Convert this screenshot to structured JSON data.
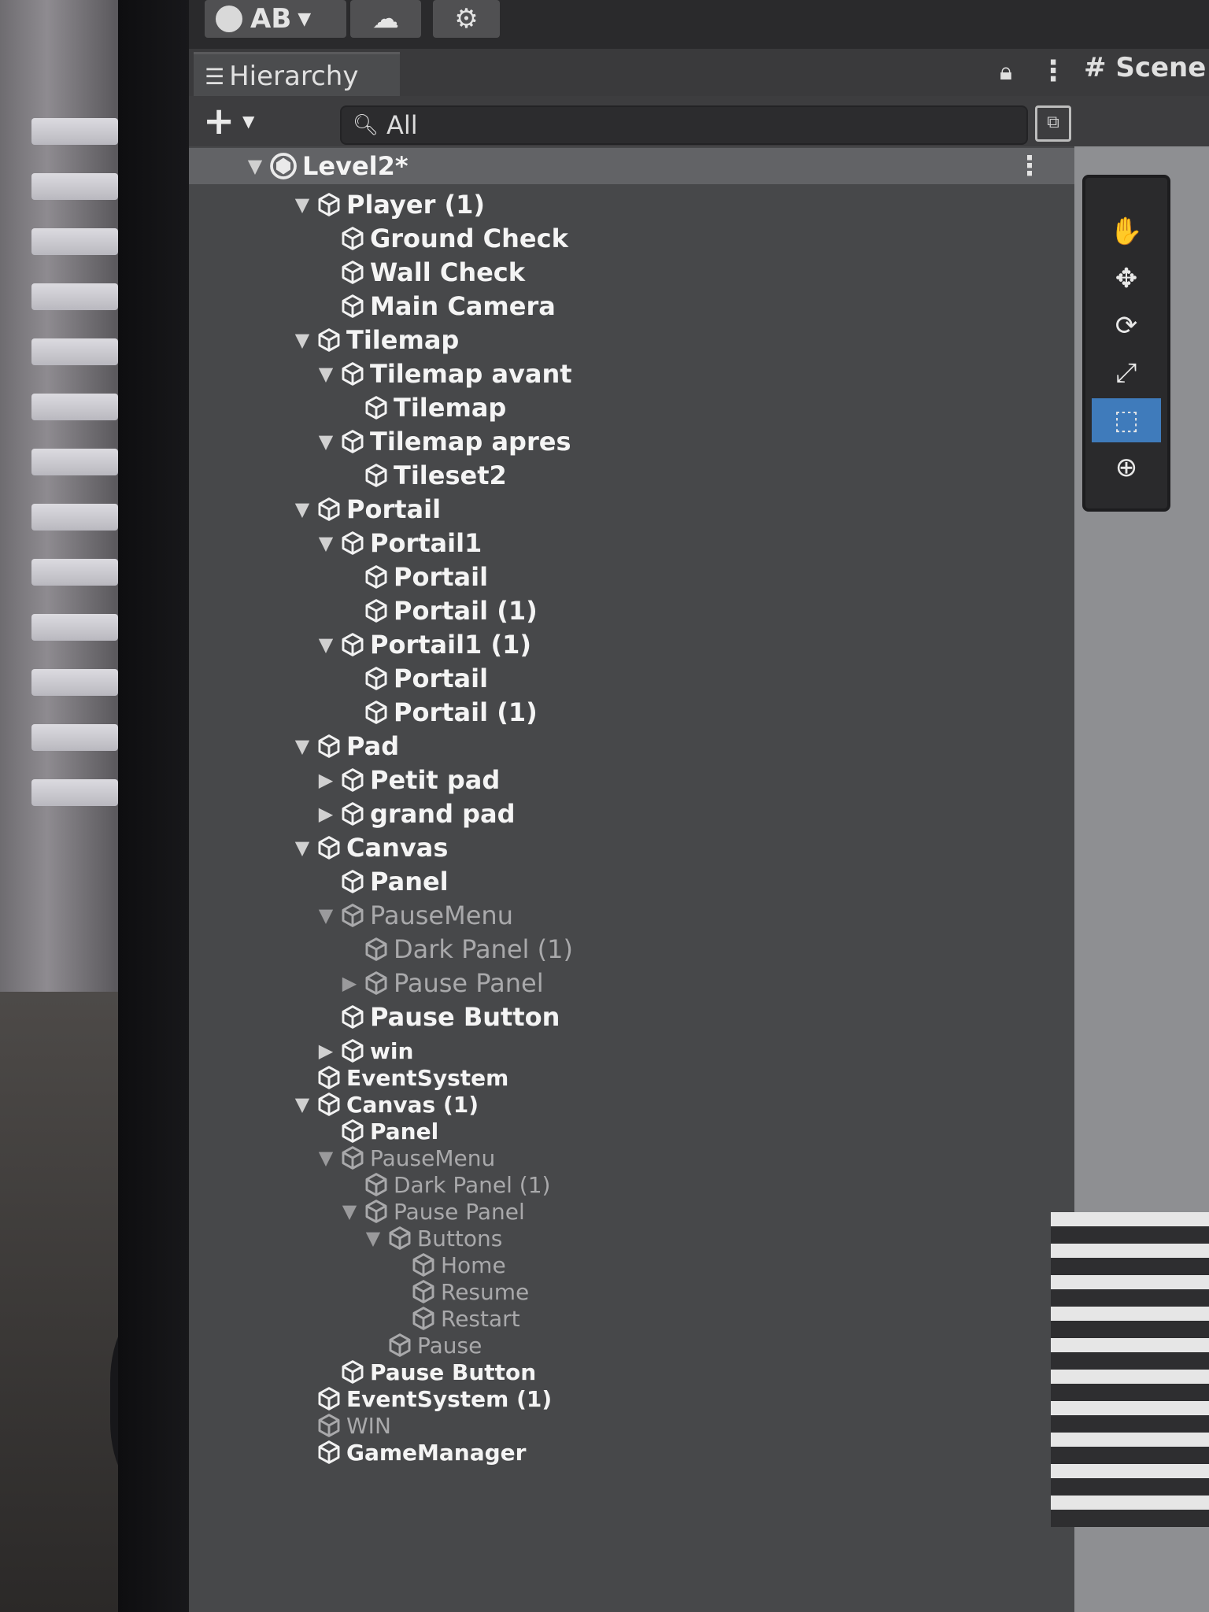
{
  "toolbar": {
    "account_label": "AB",
    "icons": [
      "account-icon",
      "cloud-icon",
      "settings-icon"
    ]
  },
  "hierarchy": {
    "tab_title": "Hierarchy",
    "search_value": "All",
    "scene_name": "Level2*",
    "items": [
      {
        "label": "Player (1)",
        "depth": 1,
        "arrow": "expanded",
        "active": true
      },
      {
        "label": "Ground Check",
        "depth": 2,
        "arrow": "none",
        "active": true
      },
      {
        "label": "Wall Check",
        "depth": 2,
        "arrow": "none",
        "active": true
      },
      {
        "label": "Main Camera",
        "depth": 2,
        "arrow": "none",
        "active": true
      },
      {
        "label": "Tilemap",
        "depth": 1,
        "arrow": "expanded",
        "active": true
      },
      {
        "label": "Tilemap avant",
        "depth": 2,
        "arrow": "expanded",
        "active": true
      },
      {
        "label": "Tilemap",
        "depth": 3,
        "arrow": "none",
        "active": true
      },
      {
        "label": "Tilemap apres",
        "depth": 2,
        "arrow": "expanded",
        "active": true
      },
      {
        "label": "Tileset2",
        "depth": 3,
        "arrow": "none",
        "active": true
      },
      {
        "label": "Portail",
        "depth": 1,
        "arrow": "expanded",
        "active": true
      },
      {
        "label": "Portail1",
        "depth": 2,
        "arrow": "expanded",
        "active": true
      },
      {
        "label": "Portail",
        "depth": 3,
        "arrow": "none",
        "active": true
      },
      {
        "label": "Portail (1)",
        "depth": 3,
        "arrow": "none",
        "active": true
      },
      {
        "label": "Portail1 (1)",
        "depth": 2,
        "arrow": "expanded",
        "active": true
      },
      {
        "label": "Portail",
        "depth": 3,
        "arrow": "none",
        "active": true
      },
      {
        "label": "Portail (1)",
        "depth": 3,
        "arrow": "none",
        "active": true
      },
      {
        "label": "Pad",
        "depth": 1,
        "arrow": "expanded",
        "active": true
      },
      {
        "label": "Petit pad",
        "depth": 2,
        "arrow": "collapsed",
        "active": true
      },
      {
        "label": "grand pad",
        "depth": 2,
        "arrow": "collapsed",
        "active": true
      },
      {
        "label": "Canvas",
        "depth": 1,
        "arrow": "expanded",
        "active": true
      },
      {
        "label": "Panel",
        "depth": 2,
        "arrow": "none",
        "active": true
      },
      {
        "label": "PauseMenu",
        "depth": 2,
        "arrow": "expanded",
        "active": false
      },
      {
        "label": "Dark Panel (1)",
        "depth": 3,
        "arrow": "none",
        "active": false
      },
      {
        "label": "Pause Panel",
        "depth": 3,
        "arrow": "collapsed",
        "active": false
      },
      {
        "label": "Pause Button",
        "depth": 2,
        "arrow": "none",
        "active": true
      },
      {
        "label": "win",
        "depth": 2,
        "arrow": "collapsed",
        "active": true
      },
      {
        "label": "EventSystem",
        "depth": 1,
        "arrow": "none",
        "active": true
      },
      {
        "label": "Canvas (1)",
        "depth": 1,
        "arrow": "expanded",
        "active": true
      },
      {
        "label": "Panel",
        "depth": 2,
        "arrow": "none",
        "active": true
      },
      {
        "label": "PauseMenu",
        "depth": 2,
        "arrow": "expanded",
        "active": false
      },
      {
        "label": "Dark Panel (1)",
        "depth": 3,
        "arrow": "none",
        "active": false
      },
      {
        "label": "Pause Panel",
        "depth": 3,
        "arrow": "expanded",
        "active": false
      },
      {
        "label": "Buttons",
        "depth": 4,
        "arrow": "expanded",
        "active": false
      },
      {
        "label": "Home",
        "depth": 5,
        "arrow": "none",
        "active": false
      },
      {
        "label": "Resume",
        "depth": 5,
        "arrow": "none",
        "active": false
      },
      {
        "label": "Restart",
        "depth": 5,
        "arrow": "none",
        "active": false
      },
      {
        "label": "Pause",
        "depth": 4,
        "arrow": "none",
        "active": false
      },
      {
        "label": "Pause Button",
        "depth": 2,
        "arrow": "none",
        "active": true
      },
      {
        "label": "EventSystem (1)",
        "depth": 1,
        "arrow": "none",
        "active": true
      },
      {
        "label": "WIN",
        "depth": 1,
        "arrow": "none",
        "active": false
      },
      {
        "label": "GameManager",
        "depth": 1,
        "arrow": "none",
        "active": true
      }
    ]
  },
  "scene": {
    "tab_title": "Scene",
    "tools": [
      "hand-icon",
      "move-icon",
      "rotate-icon",
      "scale-icon",
      "rect-tool-icon",
      "transform-icon"
    ],
    "active_tool_index": 4
  }
}
